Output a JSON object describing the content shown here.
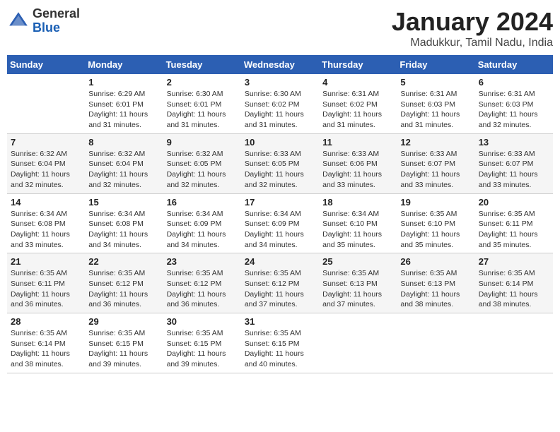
{
  "header": {
    "logo_line1": "General",
    "logo_line2": "Blue",
    "month_year": "January 2024",
    "location": "Madukkur, Tamil Nadu, India"
  },
  "weekdays": [
    "Sunday",
    "Monday",
    "Tuesday",
    "Wednesday",
    "Thursday",
    "Friday",
    "Saturday"
  ],
  "weeks": [
    [
      {
        "day": "",
        "info": ""
      },
      {
        "day": "1",
        "info": "Sunrise: 6:29 AM\nSunset: 6:01 PM\nDaylight: 11 hours\nand 31 minutes."
      },
      {
        "day": "2",
        "info": "Sunrise: 6:30 AM\nSunset: 6:01 PM\nDaylight: 11 hours\nand 31 minutes."
      },
      {
        "day": "3",
        "info": "Sunrise: 6:30 AM\nSunset: 6:02 PM\nDaylight: 11 hours\nand 31 minutes."
      },
      {
        "day": "4",
        "info": "Sunrise: 6:31 AM\nSunset: 6:02 PM\nDaylight: 11 hours\nand 31 minutes."
      },
      {
        "day": "5",
        "info": "Sunrise: 6:31 AM\nSunset: 6:03 PM\nDaylight: 11 hours\nand 31 minutes."
      },
      {
        "day": "6",
        "info": "Sunrise: 6:31 AM\nSunset: 6:03 PM\nDaylight: 11 hours\nand 32 minutes."
      }
    ],
    [
      {
        "day": "7",
        "info": "Sunrise: 6:32 AM\nSunset: 6:04 PM\nDaylight: 11 hours\nand 32 minutes."
      },
      {
        "day": "8",
        "info": "Sunrise: 6:32 AM\nSunset: 6:04 PM\nDaylight: 11 hours\nand 32 minutes."
      },
      {
        "day": "9",
        "info": "Sunrise: 6:32 AM\nSunset: 6:05 PM\nDaylight: 11 hours\nand 32 minutes."
      },
      {
        "day": "10",
        "info": "Sunrise: 6:33 AM\nSunset: 6:05 PM\nDaylight: 11 hours\nand 32 minutes."
      },
      {
        "day": "11",
        "info": "Sunrise: 6:33 AM\nSunset: 6:06 PM\nDaylight: 11 hours\nand 33 minutes."
      },
      {
        "day": "12",
        "info": "Sunrise: 6:33 AM\nSunset: 6:07 PM\nDaylight: 11 hours\nand 33 minutes."
      },
      {
        "day": "13",
        "info": "Sunrise: 6:33 AM\nSunset: 6:07 PM\nDaylight: 11 hours\nand 33 minutes."
      }
    ],
    [
      {
        "day": "14",
        "info": "Sunrise: 6:34 AM\nSunset: 6:08 PM\nDaylight: 11 hours\nand 33 minutes."
      },
      {
        "day": "15",
        "info": "Sunrise: 6:34 AM\nSunset: 6:08 PM\nDaylight: 11 hours\nand 34 minutes."
      },
      {
        "day": "16",
        "info": "Sunrise: 6:34 AM\nSunset: 6:09 PM\nDaylight: 11 hours\nand 34 minutes."
      },
      {
        "day": "17",
        "info": "Sunrise: 6:34 AM\nSunset: 6:09 PM\nDaylight: 11 hours\nand 34 minutes."
      },
      {
        "day": "18",
        "info": "Sunrise: 6:34 AM\nSunset: 6:10 PM\nDaylight: 11 hours\nand 35 minutes."
      },
      {
        "day": "19",
        "info": "Sunrise: 6:35 AM\nSunset: 6:10 PM\nDaylight: 11 hours\nand 35 minutes."
      },
      {
        "day": "20",
        "info": "Sunrise: 6:35 AM\nSunset: 6:11 PM\nDaylight: 11 hours\nand 35 minutes."
      }
    ],
    [
      {
        "day": "21",
        "info": "Sunrise: 6:35 AM\nSunset: 6:11 PM\nDaylight: 11 hours\nand 36 minutes."
      },
      {
        "day": "22",
        "info": "Sunrise: 6:35 AM\nSunset: 6:12 PM\nDaylight: 11 hours\nand 36 minutes."
      },
      {
        "day": "23",
        "info": "Sunrise: 6:35 AM\nSunset: 6:12 PM\nDaylight: 11 hours\nand 36 minutes."
      },
      {
        "day": "24",
        "info": "Sunrise: 6:35 AM\nSunset: 6:12 PM\nDaylight: 11 hours\nand 37 minutes."
      },
      {
        "day": "25",
        "info": "Sunrise: 6:35 AM\nSunset: 6:13 PM\nDaylight: 11 hours\nand 37 minutes."
      },
      {
        "day": "26",
        "info": "Sunrise: 6:35 AM\nSunset: 6:13 PM\nDaylight: 11 hours\nand 38 minutes."
      },
      {
        "day": "27",
        "info": "Sunrise: 6:35 AM\nSunset: 6:14 PM\nDaylight: 11 hours\nand 38 minutes."
      }
    ],
    [
      {
        "day": "28",
        "info": "Sunrise: 6:35 AM\nSunset: 6:14 PM\nDaylight: 11 hours\nand 38 minutes."
      },
      {
        "day": "29",
        "info": "Sunrise: 6:35 AM\nSunset: 6:15 PM\nDaylight: 11 hours\nand 39 minutes."
      },
      {
        "day": "30",
        "info": "Sunrise: 6:35 AM\nSunset: 6:15 PM\nDaylight: 11 hours\nand 39 minutes."
      },
      {
        "day": "31",
        "info": "Sunrise: 6:35 AM\nSunset: 6:15 PM\nDaylight: 11 hours\nand 40 minutes."
      },
      {
        "day": "",
        "info": ""
      },
      {
        "day": "",
        "info": ""
      },
      {
        "day": "",
        "info": ""
      }
    ]
  ]
}
